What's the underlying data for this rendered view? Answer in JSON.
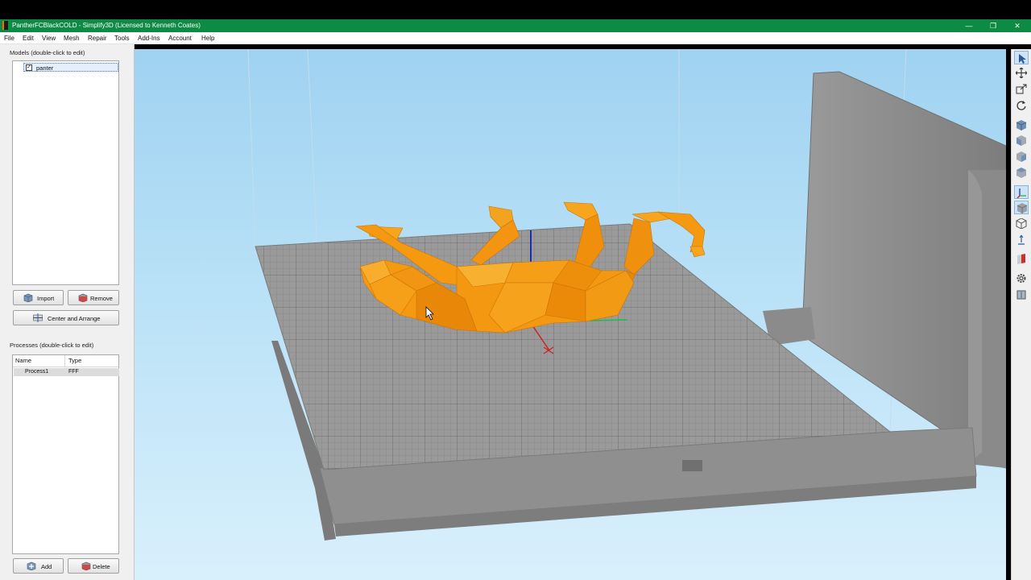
{
  "window": {
    "title": "PantherFCBlackCOLD - Simplify3D (Licensed to Kenneth Coates)",
    "minimize_glyph": "—",
    "restore_glyph": "❐",
    "close_glyph": "✕"
  },
  "menu": [
    "File",
    "Edit",
    "View",
    "Mesh",
    "Repair",
    "Tools",
    "Add-Ins",
    "Account",
    "Help"
  ],
  "models": {
    "label": "Models (double-click to edit)",
    "items": [
      {
        "name": "panter",
        "checked": true
      }
    ],
    "import_label": "Import",
    "remove_label": "Remove",
    "center_label": "Center and Arrange"
  },
  "processes": {
    "label": "Processes (double-click to edit)",
    "columns": [
      "Name",
      "Type"
    ],
    "rows": [
      {
        "name": "Process1",
        "type": "FFF"
      }
    ],
    "add_label": "Add",
    "delete_label": "Delete"
  },
  "toolbar": {
    "icons": [
      "select-icon",
      "move-icon",
      "scale-icon",
      "rotate-icon",
      "view-default-icon",
      "view-front-icon",
      "view-side-icon",
      "view-top-icon",
      "axes-icon",
      "solid-view-icon",
      "wireframe-icon",
      "normals-icon",
      "cross-section-icon",
      "settings-gear-icon",
      "machine-view-icon"
    ],
    "active": [
      "select-icon",
      "axes-icon",
      "solid-view-icon"
    ]
  },
  "colors": {
    "title_bar": "#0d8a43",
    "model": "#f59a10",
    "bed": "#8e8e8e",
    "sky_top": "#9fd2f1"
  }
}
